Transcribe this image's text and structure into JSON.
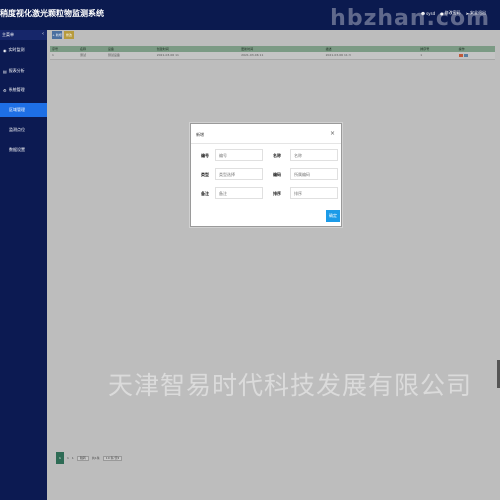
{
  "app": {
    "title": "稍度视化激光颗粒物监测系统"
  },
  "topbar": {
    "user": "sysd",
    "change_password": "修改密码",
    "logout": "安全退出"
  },
  "sidebar": {
    "header": "主菜单",
    "items": [
      {
        "label": "实时监测"
      },
      {
        "label": "报表分析"
      },
      {
        "label": "系统管理"
      },
      {
        "label": "区域管理"
      },
      {
        "label": "监测点位"
      },
      {
        "label": "数据设置"
      }
    ]
  },
  "toolbar": {
    "add_label": "新增",
    "edit_label": "修改"
  },
  "table": {
    "headers": [
      "序号",
      "名称",
      "设备",
      "创建时间",
      "更新时间",
      "描述",
      "排序号",
      "操作"
    ],
    "rows": [
      [
        "1",
        "测试",
        "测试设备",
        "2021-03-06 11",
        "2021-03-06 11",
        "2021-03-06 11:3",
        "1",
        ""
      ]
    ]
  },
  "pager": {
    "current": "1",
    "total": "共1条",
    "first": "1",
    "last": "1",
    "jump": "跳转",
    "size": "10 条/页",
    "size_select": "每页显示"
  },
  "watermark": {
    "top": "hbzhan.com",
    "bottom": "天津智易时代科技发展有限公司"
  },
  "modal": {
    "title": "新增",
    "fields": [
      {
        "label": "编号",
        "placeholder": "编号"
      },
      {
        "label": "名称",
        "placeholder": "名称"
      },
      {
        "label": "类型",
        "placeholder": "类型选择"
      },
      {
        "label": "编码",
        "placeholder": "所属编码"
      },
      {
        "label": "备注",
        "placeholder": "备注"
      },
      {
        "label": "排序",
        "placeholder": "排序"
      }
    ],
    "ok_label": "确定"
  },
  "colors": {
    "topbar": "#0b1a4f",
    "sidebar": "#0c1a52",
    "active": "#1e6fe6",
    "ok_button": "#1c9be8"
  }
}
